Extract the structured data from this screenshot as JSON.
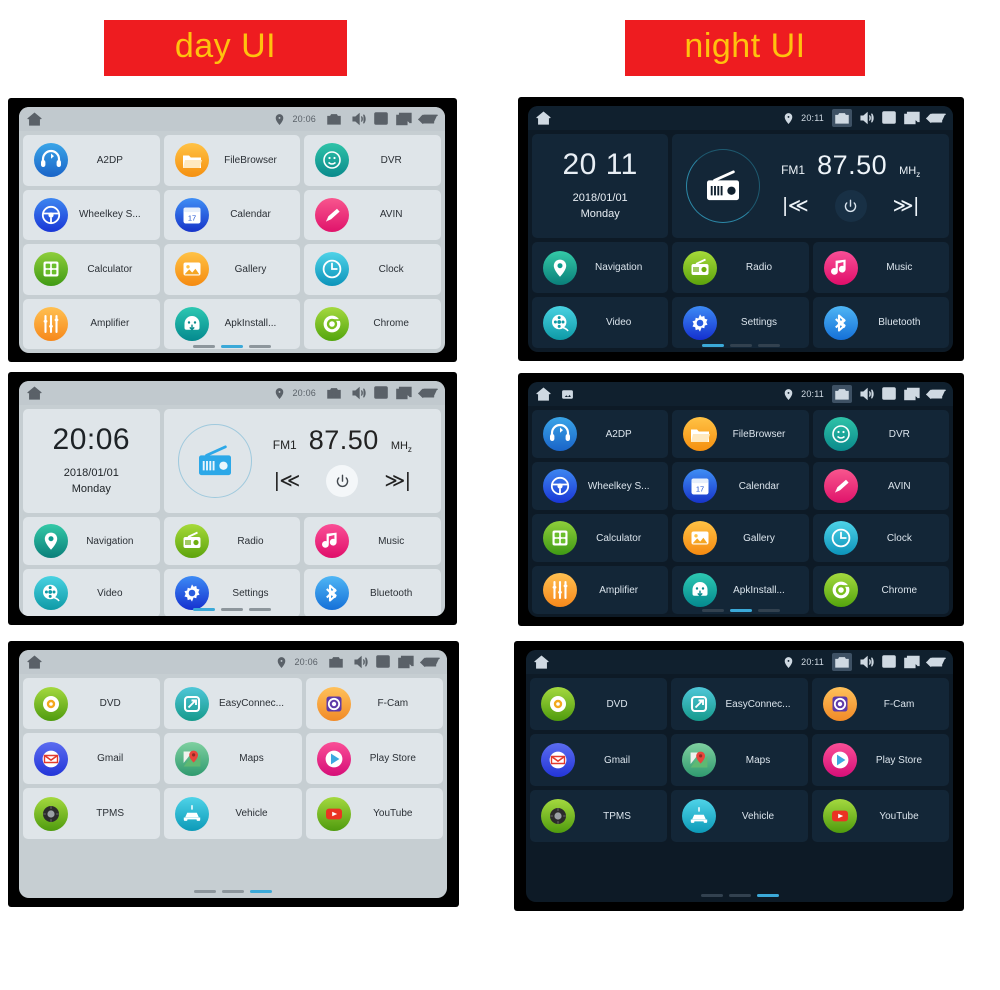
{
  "banners": {
    "day": "day UI",
    "night": "night UI",
    "bg_color": "#ee1c20",
    "text_color": "#ffc20e"
  },
  "status_bar": {
    "day_time": "20:06",
    "night_time": "20:11",
    "icons": [
      "home-icon",
      "location-pin-icon",
      "camera-icon",
      "volume-icon",
      "close-box-icon",
      "recents-icon",
      "back-icon"
    ]
  },
  "day_screens": [
    {
      "id": "day-apps-1",
      "type": "apps",
      "active_page": 1,
      "apps": [
        {
          "label": "A2DP",
          "icon": "bluetooth-headset-icon",
          "c1": "#3aa5e8",
          "c2": "#1a64c8"
        },
        {
          "label": "FileBrowser",
          "icon": "folder-icon",
          "c1": "#ffc245",
          "c2": "#f59010"
        },
        {
          "label": "DVR",
          "icon": "dvr-camera-icon",
          "c1": "#2fc3a8",
          "c2": "#0a8a8c"
        },
        {
          "label": "Wheelkey S...",
          "icon": "steering-wheel-icon",
          "c1": "#3d86f0",
          "c2": "#1a36d6"
        },
        {
          "label": "Calendar",
          "icon": "calendar-icon",
          "c1": "#3f8ef5",
          "c2": "#1734c9"
        },
        {
          "label": "AVIN",
          "icon": "avin-pen-icon",
          "c1": "#f8568e",
          "c2": "#e0136b"
        },
        {
          "label": "Calculator",
          "icon": "calculator-icon",
          "c1": "#8ece3b",
          "c2": "#3f9a14"
        },
        {
          "label": "Gallery",
          "icon": "gallery-image-icon",
          "c1": "#ffc245",
          "c2": "#f58a10"
        },
        {
          "label": "Clock",
          "icon": "clock-icon",
          "c1": "#4fd3e8",
          "c2": "#0c93ba"
        },
        {
          "label": "Amplifier",
          "icon": "equalizer-icon",
          "c1": "#ffc051",
          "c2": "#f6881b"
        },
        {
          "label": "ApkInstall...",
          "icon": "android-apk-icon",
          "c1": "#2dc8b2",
          "c2": "#04898e"
        },
        {
          "label": "Chrome",
          "icon": "chrome-icon",
          "c1": "#a4d93f",
          "c2": "#53a50d"
        }
      ]
    },
    {
      "id": "day-home",
      "type": "home",
      "active_page": 0,
      "clock": {
        "time": "20:06",
        "date": "2018/01/01",
        "weekday": "Monday"
      },
      "radio": {
        "band": "FM1",
        "frequency": "87.50",
        "unit": "MHz",
        "prev_label": "|≪",
        "power_label": "⏻",
        "next_label": "≫|"
      },
      "apps": [
        {
          "label": "Navigation",
          "icon": "map-pin-icon",
          "c1": "#34c9a7",
          "c2": "#0a7f7a"
        },
        {
          "label": "Radio",
          "icon": "radio-icon",
          "c1": "#a6da3a",
          "c2": "#5ca30c"
        },
        {
          "label": "Music",
          "icon": "music-note-icon",
          "c1": "#fa4f96",
          "c2": "#e00e6a"
        },
        {
          "label": "Video",
          "icon": "film-reel-icon",
          "c1": "#49d2e2",
          "c2": "#0e9aa6"
        },
        {
          "label": "Settings",
          "icon": "gear-icon",
          "c1": "#3d8bf5",
          "c2": "#1530cf"
        },
        {
          "label": "Bluetooth",
          "icon": "bluetooth-icon",
          "c1": "#4fb6f5",
          "c2": "#1570d8"
        }
      ]
    },
    {
      "id": "day-apps-2",
      "type": "apps",
      "active_page": 2,
      "apps": [
        {
          "label": "DVD",
          "icon": "dvd-disc-icon",
          "c1": "#a4d93f",
          "c2": "#4f9b0e"
        },
        {
          "label": "EasyConnec...",
          "icon": "easyconnect-icon",
          "c1": "#4fc7d8",
          "c2": "#169a8c"
        },
        {
          "label": "F-Cam",
          "icon": "front-camera-icon",
          "c1": "#ffc15a",
          "c2": "#f18a27"
        },
        {
          "label": "Gmail",
          "icon": "gmail-icon",
          "c1": "#5b6cf0",
          "c2": "#2335d8"
        },
        {
          "label": "Maps",
          "icon": "google-maps-icon",
          "c1": "#7fd0a0",
          "c2": "#2f9a6f"
        },
        {
          "label": "Play Store",
          "icon": "play-store-icon",
          "c1": "#fa4f96",
          "c2": "#d60e78"
        },
        {
          "label": "TPMS",
          "icon": "tire-pressure-icon",
          "c1": "#a4d93f",
          "c2": "#4f9b0e"
        },
        {
          "label": "Vehicle",
          "icon": "car-icon",
          "c1": "#4fd3e8",
          "c2": "#0c9ab8"
        },
        {
          "label": "YouTube",
          "icon": "youtube-icon",
          "c1": "#a4d93f",
          "c2": "#4f9b0e"
        }
      ]
    }
  ],
  "night_screens": [
    {
      "id": "night-home",
      "type": "home",
      "active_page": 0,
      "camera_highlighted": true,
      "clock": {
        "time": "20 11",
        "date": "2018/01/01",
        "weekday": "Monday"
      },
      "radio": {
        "band": "FM1",
        "frequency": "87.50",
        "unit": "MHz",
        "prev_label": "|≪",
        "power_label": "⏻",
        "next_label": "≫|"
      },
      "apps": [
        {
          "label": "Navigation",
          "icon": "map-pin-icon",
          "c1": "#34c9a7",
          "c2": "#0a7f7a"
        },
        {
          "label": "Radio",
          "icon": "radio-icon",
          "c1": "#a6da3a",
          "c2": "#5ca30c"
        },
        {
          "label": "Music",
          "icon": "music-note-icon",
          "c1": "#fa4f96",
          "c2": "#e00e6a"
        },
        {
          "label": "Video",
          "icon": "film-reel-icon",
          "c1": "#49d2e2",
          "c2": "#0e9aa6"
        },
        {
          "label": "Settings",
          "icon": "gear-icon",
          "c1": "#3d8bf5",
          "c2": "#1530cf"
        },
        {
          "label": "Bluetooth",
          "icon": "bluetooth-icon",
          "c1": "#4fb6f5",
          "c2": "#1570d8"
        }
      ]
    },
    {
      "id": "night-apps-1",
      "type": "apps",
      "active_page": 1,
      "camera_highlighted": true,
      "notification_icon": "image-notification-icon",
      "apps": [
        {
          "label": "A2DP",
          "icon": "bluetooth-headset-icon",
          "c1": "#3aa5e8",
          "c2": "#1a64c8"
        },
        {
          "label": "FileBrowser",
          "icon": "folder-icon",
          "c1": "#ffc245",
          "c2": "#f59010"
        },
        {
          "label": "DVR",
          "icon": "dvr-camera-icon",
          "c1": "#2fc3a8",
          "c2": "#0a8a8c"
        },
        {
          "label": "Wheelkey S...",
          "icon": "steering-wheel-icon",
          "c1": "#3d86f0",
          "c2": "#1a36d6"
        },
        {
          "label": "Calendar",
          "icon": "calendar-icon",
          "c1": "#3f8ef5",
          "c2": "#1734c9"
        },
        {
          "label": "AVIN",
          "icon": "avin-pen-icon",
          "c1": "#f8568e",
          "c2": "#e0136b"
        },
        {
          "label": "Calculator",
          "icon": "calculator-icon",
          "c1": "#8ece3b",
          "c2": "#3f9a14"
        },
        {
          "label": "Gallery",
          "icon": "gallery-image-icon",
          "c1": "#ffc245",
          "c2": "#f58a10"
        },
        {
          "label": "Clock",
          "icon": "clock-icon",
          "c1": "#4fd3e8",
          "c2": "#0c93ba"
        },
        {
          "label": "Amplifier",
          "icon": "equalizer-icon",
          "c1": "#ffc051",
          "c2": "#f6881b"
        },
        {
          "label": "ApkInstall...",
          "icon": "android-apk-icon",
          "c1": "#2dc8b2",
          "c2": "#04898e"
        },
        {
          "label": "Chrome",
          "icon": "chrome-icon",
          "c1": "#a4d93f",
          "c2": "#53a50d"
        }
      ]
    },
    {
      "id": "night-apps-2",
      "type": "apps",
      "active_page": 2,
      "camera_highlighted": true,
      "apps": [
        {
          "label": "DVD",
          "icon": "dvd-disc-icon",
          "c1": "#a4d93f",
          "c2": "#4f9b0e"
        },
        {
          "label": "EasyConnec...",
          "icon": "easyconnect-icon",
          "c1": "#4fc7d8",
          "c2": "#169a8c"
        },
        {
          "label": "F-Cam",
          "icon": "front-camera-icon",
          "c1": "#ffc15a",
          "c2": "#f18a27"
        },
        {
          "label": "Gmail",
          "icon": "gmail-icon",
          "c1": "#5b6cf0",
          "c2": "#2335d8"
        },
        {
          "label": "Maps",
          "icon": "google-maps-icon",
          "c1": "#7fd0a0",
          "c2": "#2f9a6f"
        },
        {
          "label": "Play Store",
          "icon": "play-store-icon",
          "c1": "#fa4f96",
          "c2": "#d60e78"
        },
        {
          "label": "TPMS",
          "icon": "tire-pressure-icon",
          "c1": "#a4d93f",
          "c2": "#4f9b0e"
        },
        {
          "label": "Vehicle",
          "icon": "car-icon",
          "c1": "#4fd3e8",
          "c2": "#0c9ab8"
        },
        {
          "label": "YouTube",
          "icon": "youtube-icon",
          "c1": "#a4d93f",
          "c2": "#4f9b0e"
        }
      ]
    }
  ]
}
